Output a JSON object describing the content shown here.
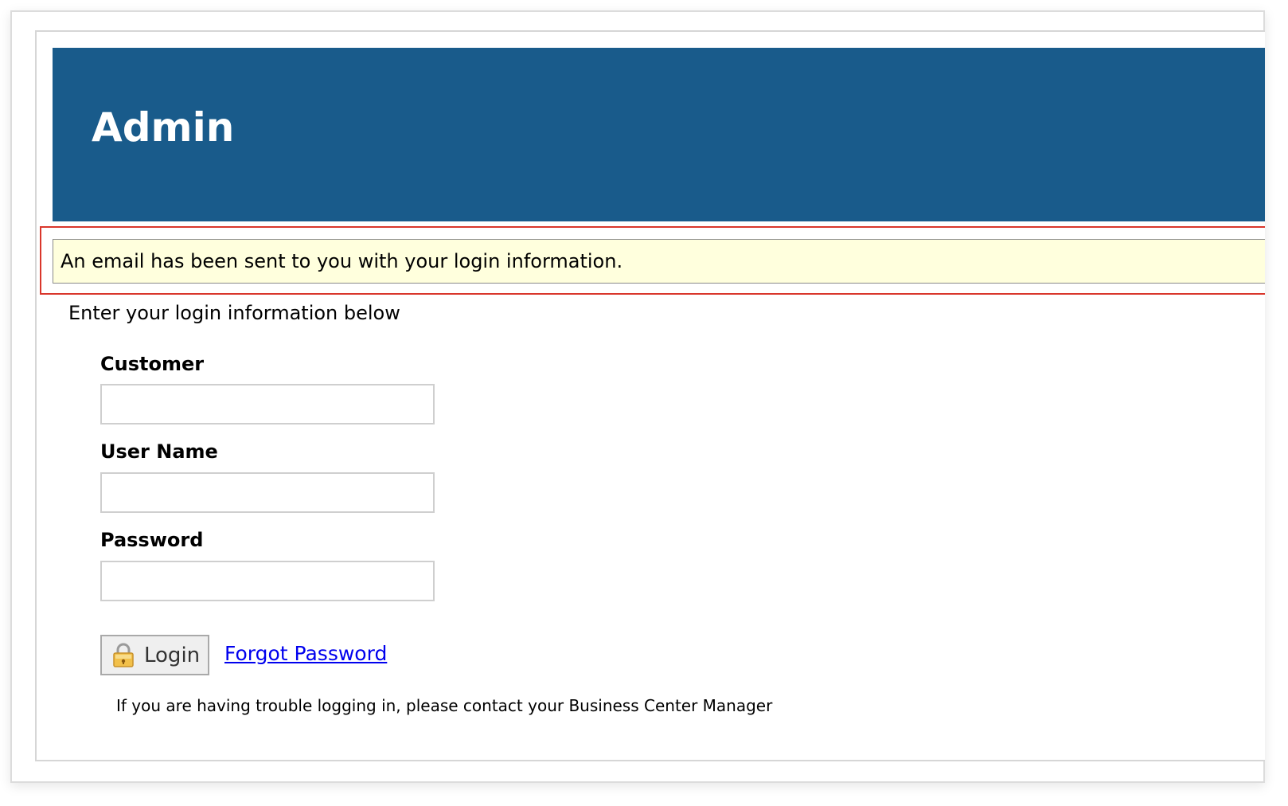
{
  "header": {
    "title": "Admin"
  },
  "notice": {
    "message": "An email has been sent to you with your login information."
  },
  "form": {
    "intro": "Enter your login information below",
    "customer": {
      "label": "Customer",
      "value": "",
      "placeholder": ""
    },
    "username": {
      "label": "User Name",
      "value": "",
      "placeholder": ""
    },
    "password": {
      "label": "Password",
      "value": "",
      "placeholder": ""
    },
    "login_button": {
      "label": "Login",
      "icon": "lock-icon"
    },
    "forgot_link": "Forgot Password",
    "help": "If you are having trouble logging in, please contact your Business Center Manager"
  },
  "colors": {
    "header_bg": "#195b8b",
    "notice_bg": "#ffffdd",
    "highlight_border": "#d9362b",
    "link": "#0000ee"
  }
}
